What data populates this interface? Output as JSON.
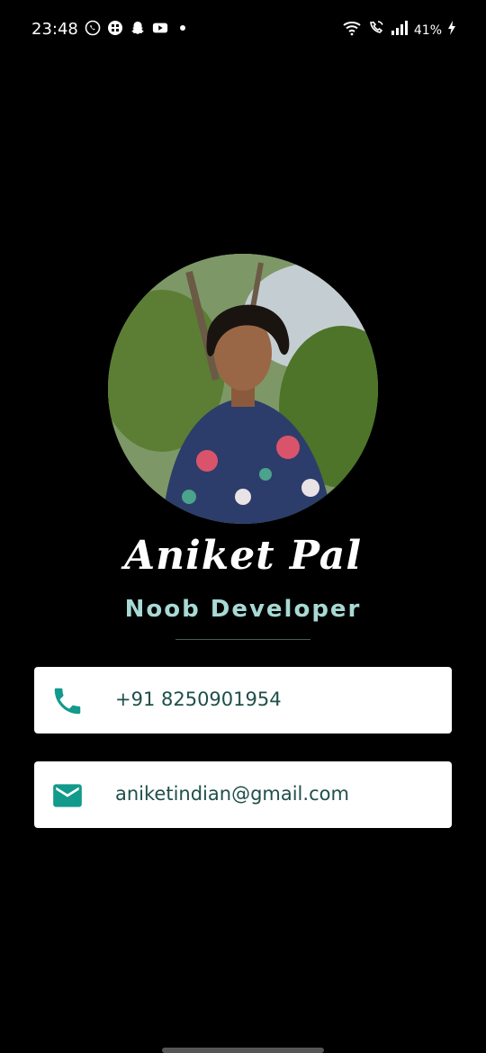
{
  "status_bar": {
    "time": "23:48",
    "left_icons": [
      "whatsapp-icon",
      "grid-app-icon",
      "snapchat-icon",
      "youtube-icon",
      "dot-icon"
    ],
    "right_icons": [
      "wifi-icon",
      "wifi-call-icon",
      "signal-icon"
    ],
    "battery": "41%"
  },
  "profile": {
    "name": "Aniket Pal",
    "title": "Noob Developer"
  },
  "contact": {
    "phone": "+91 8250901954",
    "email": "aniketindian@gmail.com"
  },
  "colors": {
    "background": "#000000",
    "title_text": "#a8d9d4",
    "card_text": "#1f4f4a",
    "icon": "#129a8c"
  }
}
